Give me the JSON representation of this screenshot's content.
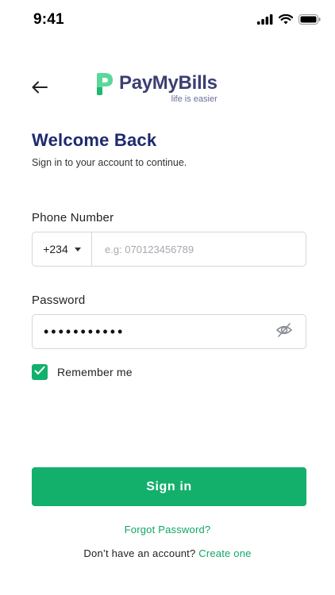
{
  "status_bar": {
    "time": "9:41",
    "icons": [
      "cellular-signal-icon",
      "wifi-icon",
      "battery-icon"
    ]
  },
  "header": {
    "back_icon": "arrow-left-icon",
    "logo_name": "PayMyBills",
    "logo_tagline": "life is easier"
  },
  "title": "Welcome Back",
  "subtitle": "Sign in to your account to continue.",
  "phone": {
    "label": "Phone Number",
    "country_code": "+234",
    "placeholder": "e.g: 070123456789",
    "value": ""
  },
  "password": {
    "label": "Password",
    "masked_value": "•••••••••••",
    "toggle_icon": "eye-off-icon"
  },
  "remember": {
    "label": "Remember me",
    "checked": true
  },
  "signin_label": "Sign in",
  "forgot_label": "Forgot Password?",
  "signup": {
    "prompt": "Don’t have an account?",
    "link_label": "Create one"
  },
  "colors": {
    "primary": "#13b06b",
    "title": "#1d2a6e",
    "logo_text": "#3b3f73",
    "border": "#d4d6dc"
  }
}
